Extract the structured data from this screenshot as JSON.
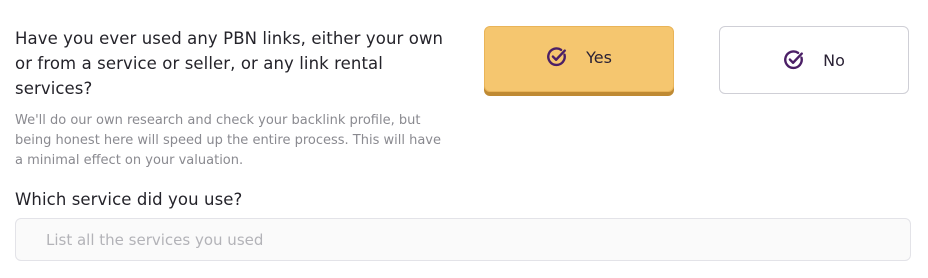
{
  "question": {
    "text": "Have you ever used any PBN links, either your own or from a service or seller, or any link rental services?",
    "helper": "We'll do our own research and check your backlink profile, but being honest here will speed up the entire process. This will have a minimal effect on your valuation."
  },
  "options": {
    "yes": {
      "label": "Yes",
      "icon": "check-circle-icon",
      "selected": true
    },
    "no": {
      "label": "No",
      "icon": "check-circle-icon",
      "selected": false
    }
  },
  "followup": {
    "label": "Which service did you use?",
    "input_value": "",
    "placeholder": "List all the services you used"
  },
  "colors": {
    "selected_bg": "#f5c66f",
    "selected_shadow": "#bf8a33",
    "icon": "#4b1f66"
  }
}
